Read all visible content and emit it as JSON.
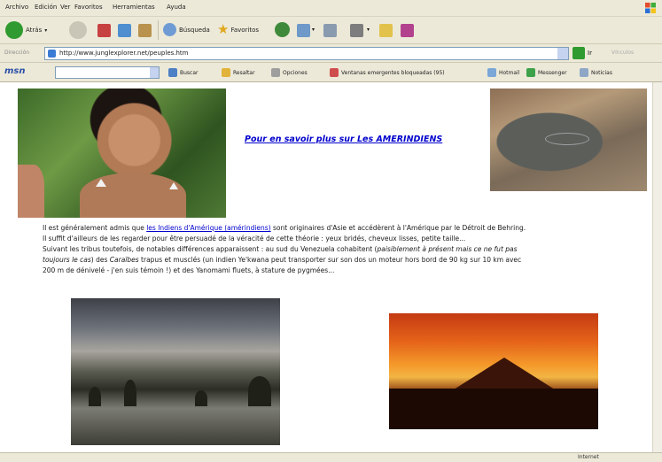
{
  "menu": [
    "Archivo",
    "Edición",
    "Ver",
    "Favoritos",
    "Herramientas",
    "Ayuda"
  ],
  "toolbar": {
    "back_label": "Atrás",
    "search_label": "Búsqueda",
    "favorites_label": "Favoritos"
  },
  "address": {
    "label": "Dirección",
    "url": "http://www.junglexplorer.net/peuples.htm",
    "go_label": "Ir",
    "links_label": "Vínculos"
  },
  "msn_bar": {
    "logo": "msn",
    "search_value": "",
    "buttons": [
      "Buscar",
      "Resaltar",
      "Opciones",
      "Ventanas emergentes bloqueadas (95)",
      "Hotmail",
      "Messenger",
      "Noticias"
    ]
  },
  "page": {
    "headline": "Pour en savoir plus sur Les AMERINDIENS",
    "para": {
      "l1_pre": "Il est généralement admis que ",
      "l1_link": "les Indiens d'Amérique (amérindiens)",
      "l1_post": " sont originaires d'Asie et accédèrent à l'Amérique par le Détroit de Behring.",
      "l2": "Il suffit d'ailleurs de les regarder pour être persuadé de la véracité de cette théorie : yeux bridés, cheveux lisses, petite taille...",
      "l3_pre": "Suivant les tribus toutefois, de notables différences apparaissent : au sud du Venezuela cohabitent (",
      "l3_it": "paisiblement à présent mais ce ne fut pas",
      "l4_it": "toujours le cas",
      "l4_mid1": ") des ",
      "l4_it2": "Caraïbes",
      "l4_mid2": " trapus et musclés (un indien Ye'kwana peut transporter sur son dos un moteur hors bord de 90 kg sur 10 km avec",
      "l5": "200 m de dénivelé - j'en suis témoin !) et des Yanomami fluets, à stature de pygmées..."
    }
  },
  "status": {
    "zone": "Internet"
  },
  "colors": {
    "chrome": "#ece9d8",
    "link": "#0000cc"
  }
}
